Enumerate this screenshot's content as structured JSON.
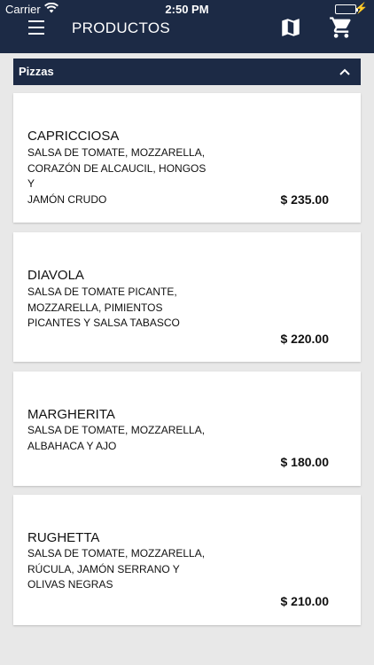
{
  "status_bar": {
    "carrier": "Carrier",
    "time": "2:50 PM",
    "battery_color": "#34c759"
  },
  "header": {
    "title": "PRODUCTOS",
    "menu_icon": "hamburger-menu-icon",
    "map_icon": "map-icon",
    "cart_icon": "shopping-cart-icon",
    "background": "#1c2a45"
  },
  "category": {
    "label": "Pizzas",
    "expanded": true,
    "toggle_icon": "chevron-up-icon"
  },
  "products": [
    {
      "name": "CAPRICCIOSA",
      "desc": [
        "SALSA DE TOMATE, MOZZARELLA,",
        "CORAZÓN DE ALCAUCIL, HONGOS Y",
        "JAMÓN CRUDO"
      ],
      "price": "$ 235.00"
    },
    {
      "name": "DIAVOLA",
      "desc": [
        "SALSA DE TOMATE PICANTE,",
        "MOZZARELLA, PIMIENTOS",
        "PICANTES Y SALSA TABASCO"
      ],
      "price": "$ 220.00"
    },
    {
      "name": "MARGHERITA",
      "desc": [
        "SALSA DE TOMATE, MOZZARELLA,",
        "ALBAHACA Y AJO"
      ],
      "price": "$ 180.00"
    },
    {
      "name": "RUGHETTA",
      "desc": [
        "SALSA DE TOMATE, MOZZARELLA,",
        "RÚCULA, JAMÓN SERRANO Y",
        "OLIVAS NEGRAS"
      ],
      "price": "$ 210.00"
    }
  ]
}
